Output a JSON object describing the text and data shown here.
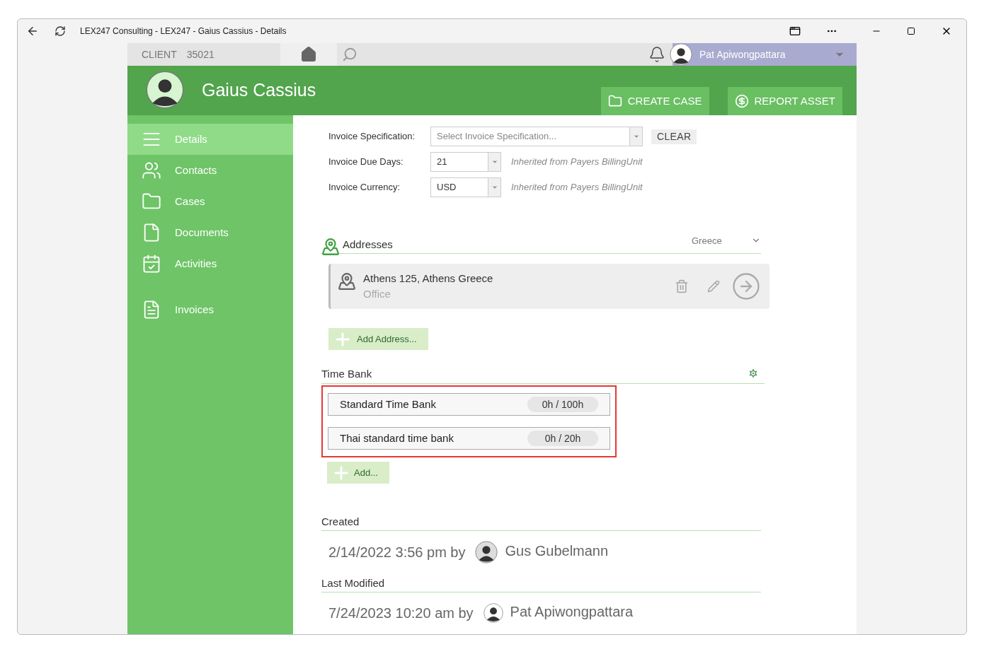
{
  "window": {
    "title": "LEX247 Consulting - LEX247 - Gaius Cassius - Details"
  },
  "topbar": {
    "client_label": "CLIENT",
    "client_number": "35021",
    "user_name": "Pat Apiwongpattara"
  },
  "header": {
    "name": "Gaius Cassius",
    "actions": [
      {
        "label": "CREATE CASE",
        "kind": "case"
      },
      {
        "label": "REPORT ASSET",
        "kind": "asset"
      }
    ]
  },
  "sidebar": {
    "items": [
      {
        "label": "Details",
        "kind": "details",
        "selected": true
      },
      {
        "label": "Contacts",
        "kind": "contacts",
        "selected": false
      },
      {
        "label": "Cases",
        "kind": "cases",
        "selected": false
      },
      {
        "label": "Documents",
        "kind": "documents",
        "selected": false
      },
      {
        "label": "Activities",
        "kind": "activities",
        "selected": false
      },
      {
        "label": "Invoices",
        "kind": "invoices",
        "selected": false
      }
    ]
  },
  "form": {
    "rows": [
      {
        "label": "Invoice Specification:",
        "placeholder": "Select Invoice Specification...",
        "kind": "wide",
        "action": "CLEAR"
      },
      {
        "label": "Invoice Due Days:",
        "value": "21",
        "kind": "narrow",
        "note": "Inherited from Payers BillingUnit"
      },
      {
        "label": "Invoice Currency:",
        "value": "USD",
        "kind": "narrow",
        "note": "Inherited from Payers BillingUnit"
      }
    ]
  },
  "addresses": {
    "title": "Addresses",
    "filter": "Greece",
    "items": [
      {
        "line": "Athens 125, Athens Greece",
        "type": "Office"
      }
    ],
    "add_button": "Add Address..."
  },
  "time_bank": {
    "title": "Time Bank",
    "highlighted": true,
    "items": [
      {
        "name": "Standard Time Bank",
        "hours": "0h / 100h"
      },
      {
        "name": "Thai standard time bank",
        "hours": "0h / 20h"
      }
    ],
    "add_button": "Add..."
  },
  "created": {
    "label": "Created",
    "date": "2/14/2022 3:56 pm by",
    "user": "Gus Gubelmann"
  },
  "last_modified": {
    "label": "Last Modified",
    "date": "7/24/2023 10:20 am by",
    "user": "Pat Apiwongpattara"
  }
}
